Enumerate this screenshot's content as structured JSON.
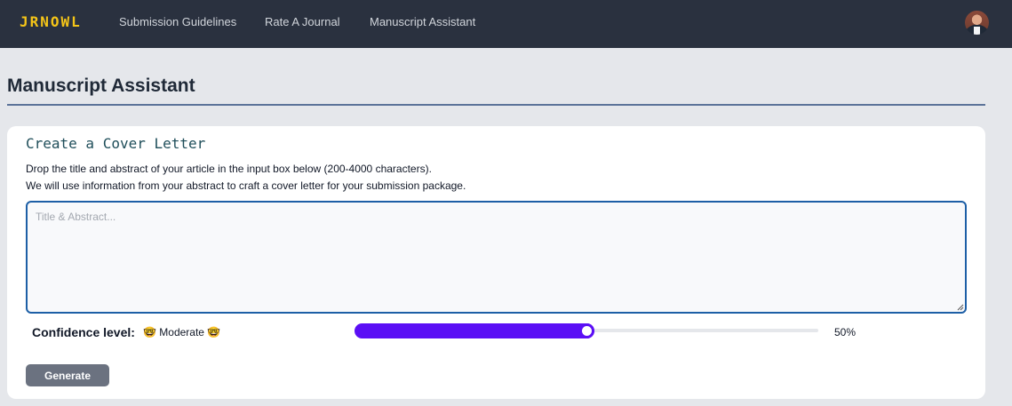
{
  "nav": {
    "logo": "JRNOWL",
    "links": [
      "Submission Guidelines",
      "Rate A Journal",
      "Manuscript Assistant"
    ]
  },
  "page": {
    "title": "Manuscript Assistant"
  },
  "card": {
    "title": "Create a Cover Letter",
    "desc_line1": "Drop the title and abstract of your article in the input box below (200-4000 characters).",
    "desc_line2": "We will use information from your abstract to craft a cover letter for your submission package.",
    "textarea": {
      "value": "",
      "placeholder": "Title & Abstract..."
    },
    "confidence": {
      "label": "Confidence level:",
      "value_text": "🤓 Moderate 🤓",
      "percent_text": "50%",
      "percent": 50
    },
    "generate_label": "Generate"
  },
  "colors": {
    "navbar": "#2a313f",
    "logo": "#f5c518",
    "accent": "#5b0ff5",
    "textarea_border": "#1d5fa6",
    "button": "#6b7280"
  },
  "icons": {
    "avatar": "user-avatar-photo"
  }
}
